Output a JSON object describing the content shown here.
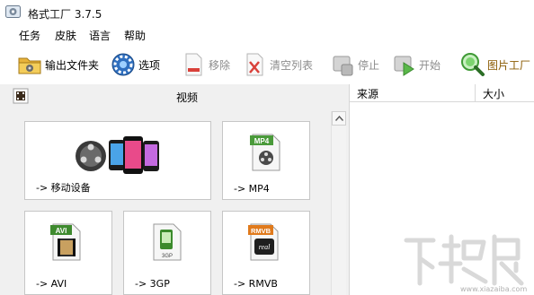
{
  "window": {
    "title": "格式工厂 3.7.5"
  },
  "menu": {
    "items": [
      "任务",
      "皮肤",
      "语言",
      "帮助"
    ]
  },
  "toolbar": {
    "output_folder": "输出文件夹",
    "options": "选项",
    "remove": "移除",
    "clear_list": "清空列表",
    "stop": "停止",
    "start": "开始",
    "image_tool": "图片工厂"
  },
  "category": {
    "title": "视频"
  },
  "cards": {
    "mobile": "-> 移动设备",
    "mp4": "-> MP4",
    "avi": "-> AVI",
    "gp3": "-> 3GP",
    "rmvb": "-> RMVB"
  },
  "file_icons": {
    "mp4": "MP4",
    "avi": "AVI",
    "gp3": "3GP",
    "rmvb": "RMVB",
    "real": "real"
  },
  "columns": {
    "source": "来源",
    "size": "大小"
  },
  "watermark": {
    "url": "www.xiazaiba.com"
  },
  "colors": {
    "accent": "#4a9fe0",
    "disabled_text": "#8c8c8c",
    "panel_bg": "#f0f0f0"
  }
}
